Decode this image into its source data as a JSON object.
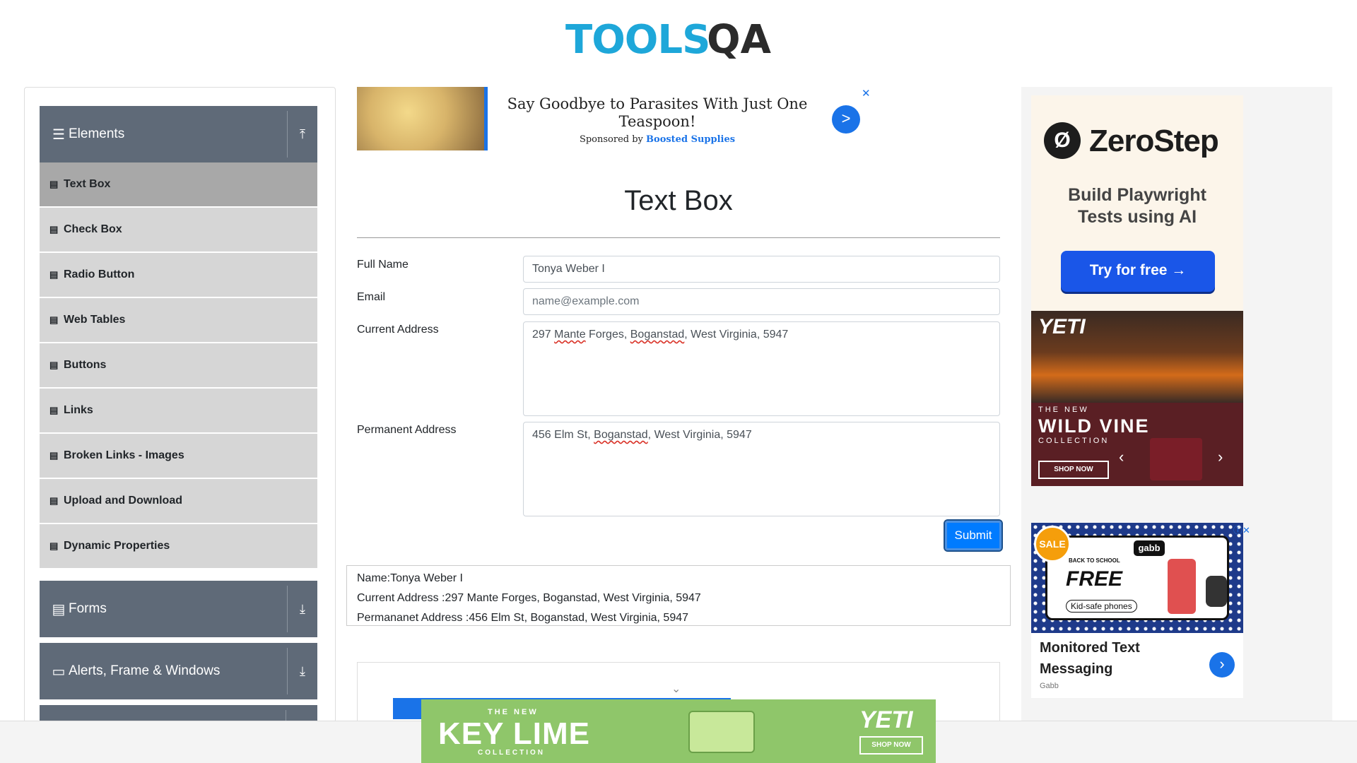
{
  "header": {
    "logo_tools": "TOOLS",
    "logo_qa": "QA"
  },
  "sidebar": {
    "groups": [
      {
        "label": "Elements",
        "icon": "hamburger-icon",
        "toggle_icon": "collapse-up-icon"
      },
      {
        "label": "Forms",
        "icon": "document-icon",
        "toggle_icon": "expand-down-icon"
      },
      {
        "label": "Alerts, Frame & Windows",
        "icon": "window-icon",
        "toggle_icon": "expand-down-icon"
      }
    ],
    "items": [
      {
        "label": "Text Box",
        "active": true
      },
      {
        "label": "Check Box"
      },
      {
        "label": "Radio Button"
      },
      {
        "label": "Web Tables"
      },
      {
        "label": "Buttons"
      },
      {
        "label": "Links"
      },
      {
        "label": "Broken Links - Images"
      },
      {
        "label": "Upload and Download"
      },
      {
        "label": "Dynamic Properties"
      }
    ]
  },
  "top_ad": {
    "title": "Say Goodbye to Parasites With Just One Teaspoon!",
    "sponsored_prefix": "Sponsored by",
    "sponsor": "Boosted Supplies",
    "go": ">",
    "close": "✕"
  },
  "main": {
    "title": "Text Box",
    "full_name_label": "Full Name",
    "full_name_value": "Tonya Weber I",
    "email_label": "Email",
    "email_placeholder": "name@example.com",
    "current_address_label": "Current Address",
    "current_address_parts": [
      "297 ",
      "Mante",
      " Forges, ",
      "Boganstad",
      ", West Virginia, 5947"
    ],
    "permanent_address_label": "Permanent Address",
    "permanent_address_parts": [
      "456 Elm St, ",
      "Boganstad",
      ", West Virginia, 5947"
    ],
    "submit_label": "Submit"
  },
  "output": {
    "name": "Name:Tonya Weber I",
    "current_address": "Current Address :297 Mante Forges, Boganstad, West Virginia, 5947",
    "permanent_address": "Permananet Address :456 Elm St, Boganstad, West Virginia, 5947"
  },
  "right_ads": {
    "zerostep": {
      "logo": "Ø",
      "name": "ZeroStep",
      "tagline_1": "Build Playwright",
      "tagline_2": "Tests using AI",
      "cta": "Try for free →"
    },
    "yeti": {
      "brand": "YETI",
      "the_new": "THE NEW",
      "name": "WILD VINE",
      "collection": "COLLECTION",
      "cta": "SHOP NOW",
      "prev": "‹",
      "next": "›"
    },
    "gabb": {
      "sale": "SALE",
      "logo": "gabb",
      "back_to_school": "BACK TO SCHOOL",
      "free": "FREE",
      "kid_safe": "Kid-safe phones",
      "title": "Monitored Text Messaging",
      "source": "Gabb",
      "go": "›",
      "close": "ⓘ✕"
    }
  },
  "bottom_ad": {
    "the_new": "THE NEW",
    "name": "KEY LIME",
    "collection": "COLLECTION",
    "brand": "YETI",
    "cta": "SHOP NOW"
  },
  "colors": {
    "sidebar_group": "#5f6a78",
    "sidebar_item": "#d6d6d6",
    "sidebar_active": "#a8a8a8",
    "primary": "#007bff",
    "logo_blue": "#1ea7d9"
  }
}
